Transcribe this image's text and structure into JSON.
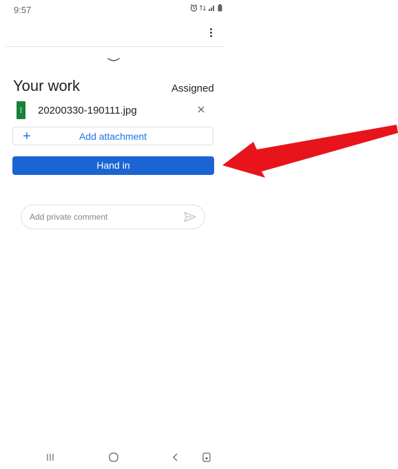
{
  "status_bar": {
    "time": "9:57"
  },
  "header": {
    "menu_icon": "overflow-menu-icon",
    "collapse_icon": "chevron-down-icon"
  },
  "work": {
    "title": "Your work",
    "status": "Assigned",
    "attachment": {
      "file_name": "20200330-190111.jpg",
      "icon": "image-file-icon"
    },
    "add_attachment_label": "Add attachment",
    "hand_in_label": "Hand in"
  },
  "comment": {
    "placeholder": "Add private comment"
  },
  "nav_bar": {
    "icons": [
      "recent-apps-icon",
      "home-icon",
      "back-icon",
      "assistant-icon"
    ]
  },
  "colors": {
    "accent": "#1a73e8",
    "hand_in_bg": "#1a64d4",
    "annotation_arrow": "#e8141c"
  }
}
